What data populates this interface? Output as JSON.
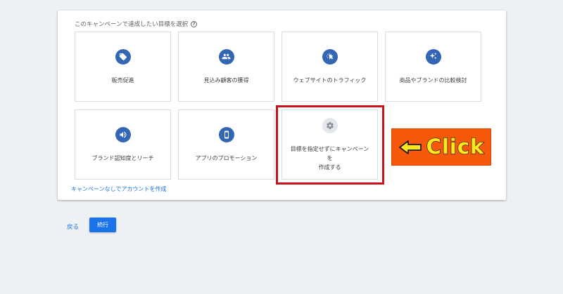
{
  "card": {
    "title": "このキャンペーンで達成したい目標を選択"
  },
  "goals": [
    {
      "label": "販売促進",
      "icon": "tag-icon"
    },
    {
      "label": "見込み顧客の獲得",
      "icon": "people-icon"
    },
    {
      "label": "ウェブサイトのトラフィック",
      "icon": "cursor-click-icon"
    },
    {
      "label": "商品やブランドの比較検討",
      "icon": "sparkle-icon"
    },
    {
      "label": "ブランド認知度とリーチ",
      "icon": "speaker-icon"
    },
    {
      "label": "アプリのプロモーション",
      "icon": "phone-icon"
    },
    {
      "label": "目標を指定せずにキャンペーンを\n作成する",
      "icon": "gear-icon"
    }
  ],
  "links": {
    "no_campaign": "キャンペーンなしでアカウントを作成",
    "back": "戻る"
  },
  "buttons": {
    "continue": "続行"
  },
  "annotation": {
    "text": "Click"
  },
  "colors": {
    "primary": "#1a73e8",
    "icon_blue": "#3367b5",
    "highlight_red": "#c8121c",
    "badge_orange": "#f7580a",
    "badge_text": "#ffe81a"
  }
}
